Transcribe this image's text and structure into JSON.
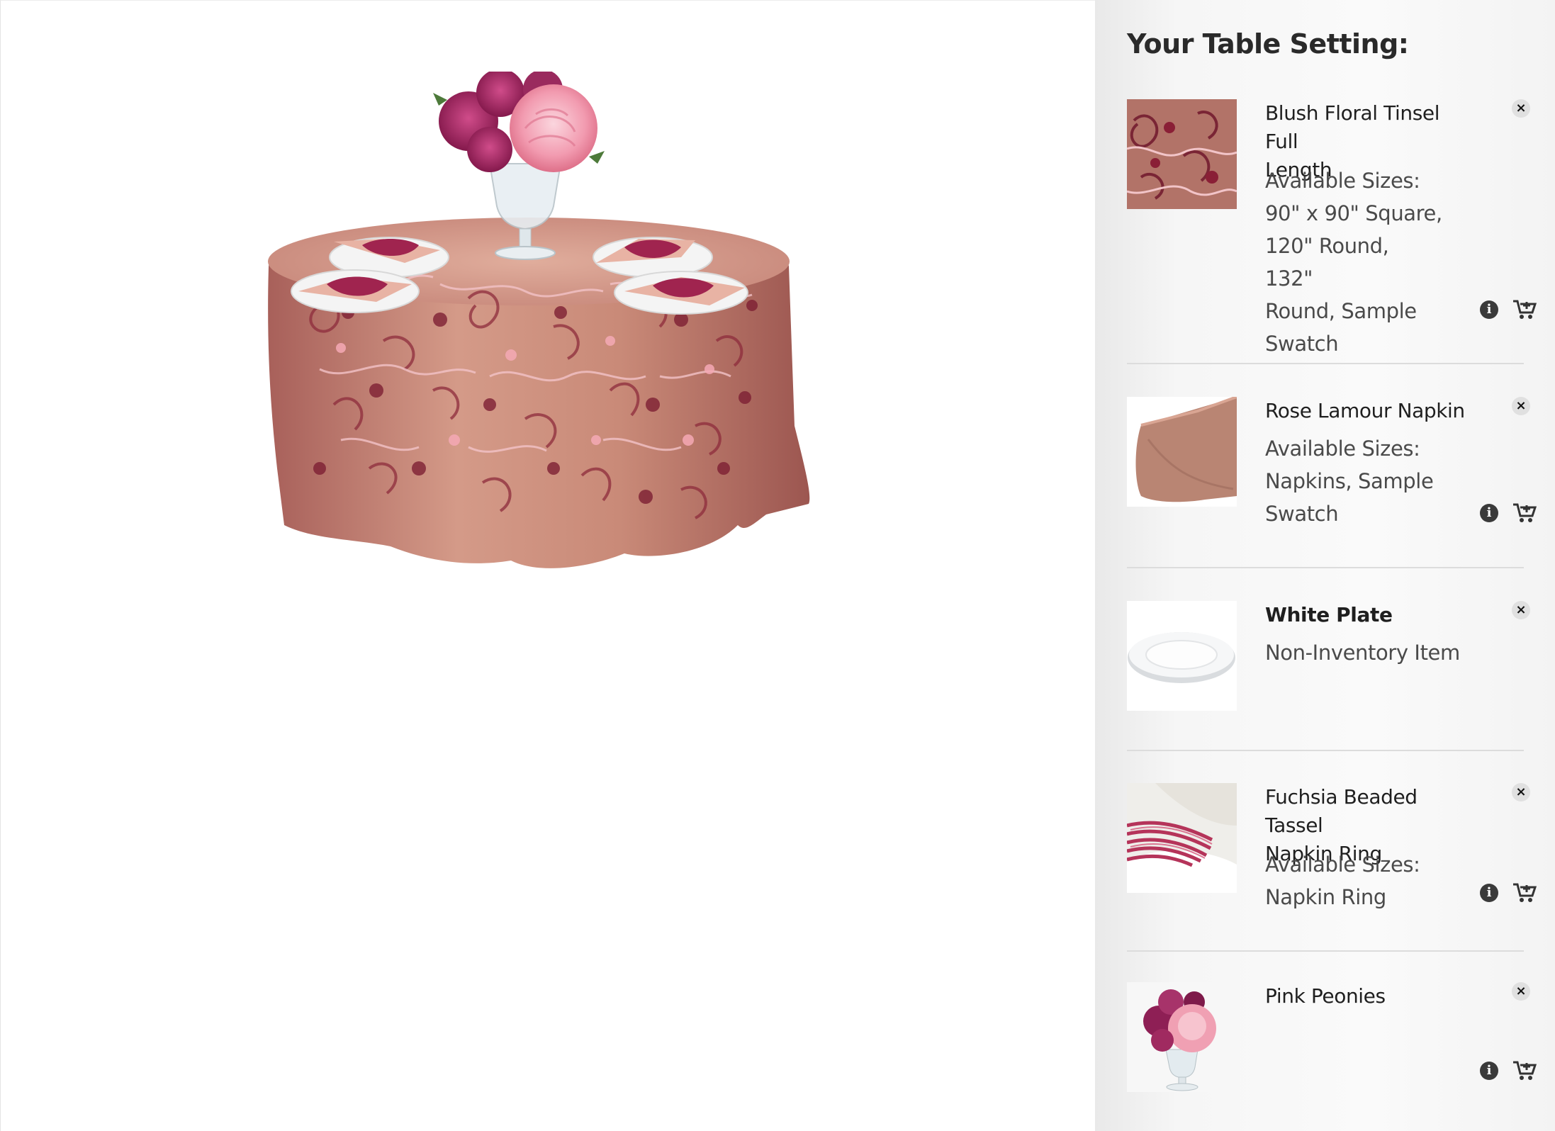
{
  "sidebar": {
    "title": "Your Table Setting:",
    "items": [
      {
        "name_line1": "Blush Floral Tinsel Full",
        "name_line2": "Length",
        "sizes_lines": [
          "Available Sizes:",
          "90\" x 90\" Square,",
          "120\" Round, 132\"",
          "Round, Sample",
          "Swatch"
        ],
        "thumb": "blush-floral-tablecloth-swatch"
      },
      {
        "name_line1": "Rose Lamour Napkin",
        "sizes_lines": [
          "Available Sizes:",
          "Napkins, Sample",
          "Swatch"
        ],
        "thumb": "rose-napkin"
      },
      {
        "name_line1": "White Plate",
        "sizes_lines": [
          "Non-Inventory Item"
        ],
        "thumb": "white-plate"
      },
      {
        "name_line1": "Fuchsia Beaded Tassel",
        "name_line2": "Napkin Ring",
        "sizes_lines": [
          "Available Sizes:",
          "Napkin Ring"
        ],
        "thumb": "beaded-napkin-ring"
      },
      {
        "name_line1": "Pink Peonies",
        "thumb": "peony-centerpiece"
      }
    ]
  },
  "colors": {
    "tablecloth": "#c9877a",
    "accent_fuchsia": "#a0244f",
    "sidebar_bg": "#f6f6f6",
    "icon_dark": "#3a3a3a"
  }
}
